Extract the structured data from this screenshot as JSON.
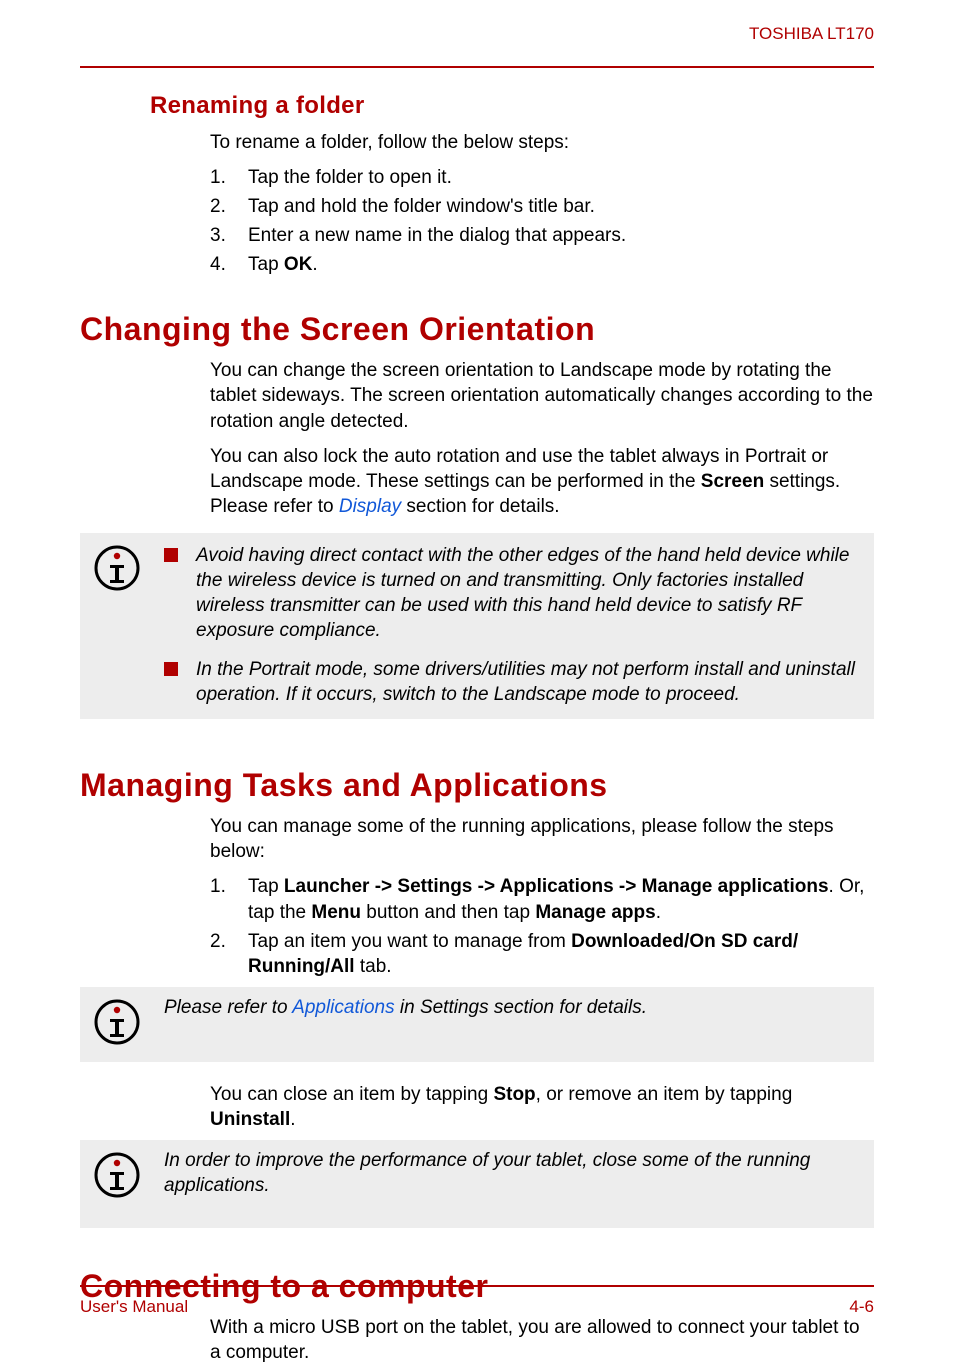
{
  "header": {
    "brand": "TOSHIBA LT170"
  },
  "footer": {
    "left": "User's Manual",
    "right": "4-6"
  },
  "sec1": {
    "title": "Renaming a folder",
    "intro": "To rename a folder, follow the below steps:",
    "steps": {
      "n1": "1.",
      "t1": "Tap the folder to open it.",
      "n2": "2.",
      "t2": "Tap and hold the folder window's title bar.",
      "n3": "3.",
      "t3": "Enter a new name in the dialog that appears.",
      "n4": "4.",
      "t4a": "Tap ",
      "t4b": "OK",
      "t4c": "."
    }
  },
  "sec2": {
    "title": "Changing the Screen Orientation",
    "p1": "You can change the screen orientation to Landscape mode by rotating the tablet sideways. The screen orientation automatically changes according to the rotation angle detected.",
    "p2a": "You can also lock the auto rotation and use the tablet always in Portrait or Landscape mode. These settings can be performed in the ",
    "p2b": "Screen",
    "p2c": " settings. Please refer to ",
    "p2link": "Display",
    "p2d": " section for details.",
    "note1": "Avoid having direct contact with the other edges of the hand held device while the wireless device is turned on and transmitting. Only factories installed wireless transmitter can be used with this hand held device to satisfy RF exposure compliance.",
    "note2": "In the Portrait mode, some drivers/utilities may not perform install and uninstall operation. If it occurs, switch to the Landscape mode to proceed."
  },
  "sec3": {
    "title": "Managing Tasks and Applications",
    "p1": "You can manage some of the running applications, please follow the steps below:",
    "steps": {
      "n1": "1.",
      "t1a": "Tap ",
      "t1b": "Launcher -> Settings -> Applications -> Manage applications",
      "t1c": ". Or, tap the ",
      "t1d": "Menu",
      "t1e": " button and then tap ",
      "t1f": "Manage apps",
      "t1g": ".",
      "n2": "2.",
      "t2a": "Tap an item you want to manage from ",
      "t2b": "Downloaded/On SD card/ Running/All",
      "t2c": " tab."
    },
    "noteA_a": "Please refer to ",
    "noteA_link": "Applications",
    "noteA_b": " in Settings section for details.",
    "p2a": "You can close an item by tapping ",
    "p2b": "Stop",
    "p2c": ", or remove an item by tapping ",
    "p2d": "Uninstall",
    "p2e": ".",
    "noteB": "In order to improve the performance of your tablet, close some of the running applications."
  },
  "sec4": {
    "title": "Connecting to a computer",
    "p1": "With a micro USB port on the tablet, you are allowed to connect your tablet to a computer."
  }
}
